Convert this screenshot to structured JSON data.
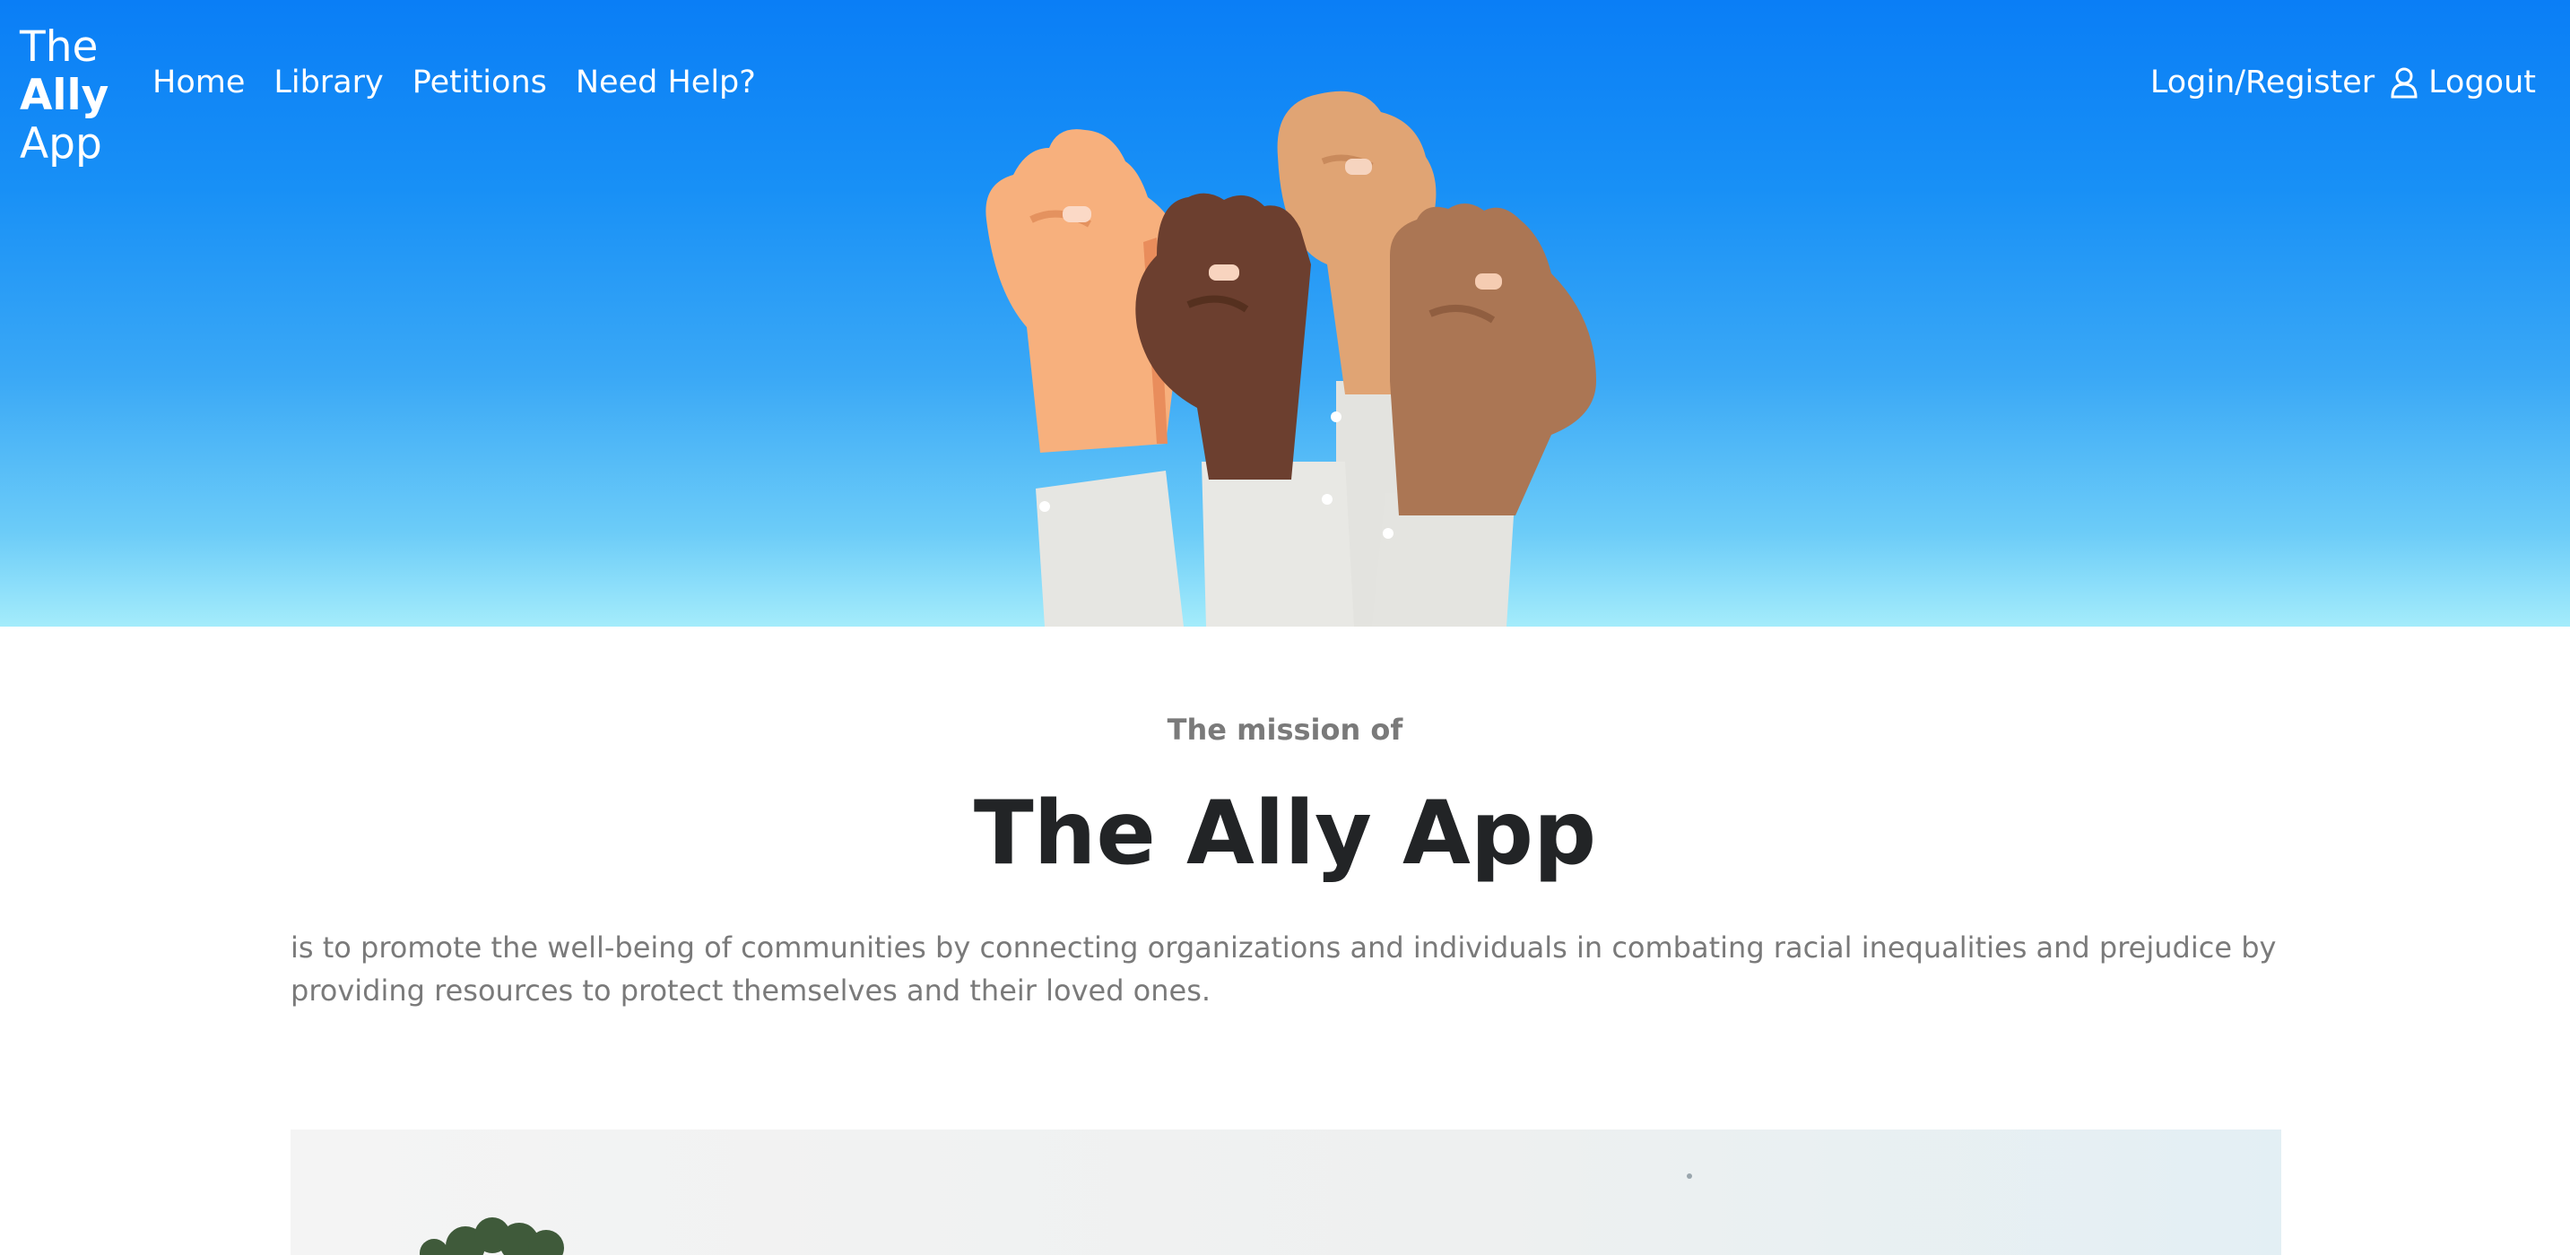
{
  "header": {
    "logo": {
      "line1": "The",
      "line2": "Ally",
      "line3": "App"
    },
    "nav": [
      {
        "label": "Home"
      },
      {
        "label": "Library"
      },
      {
        "label": "Petitions"
      },
      {
        "label": "Need Help?"
      }
    ],
    "auth": {
      "login_label": "Login/Register",
      "logout_label": "Logout"
    }
  },
  "hero": {
    "image_subject": "raised-fists-illustration"
  },
  "mission": {
    "kicker": "The mission of",
    "title": "The Ally App",
    "text": "is to promote the well-being of communities by connecting organizations and individuals in combating racial inequalities and prejudice by providing resources to protect themselves and their loved ones."
  },
  "colors": {
    "hero_top": "#0a7ef6",
    "hero_bottom": "#a4ecfb",
    "title_text": "#222426",
    "body_text": "#7a7a7a"
  }
}
